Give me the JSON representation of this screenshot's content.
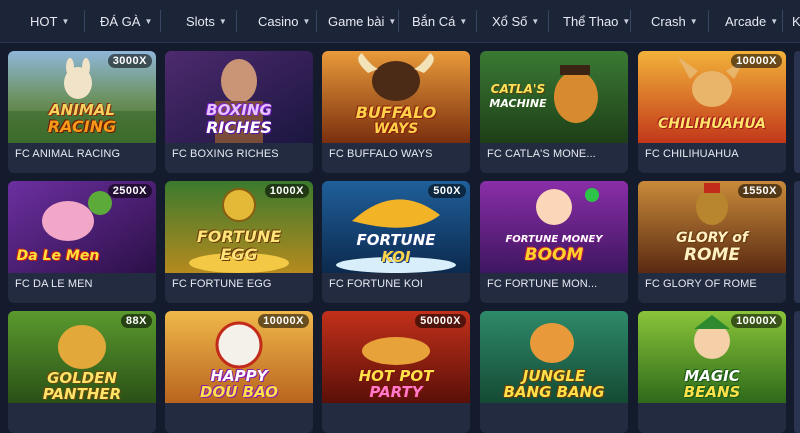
{
  "nav": {
    "items": [
      {
        "label": "HOT"
      },
      {
        "label": "ĐÁ GÀ"
      },
      {
        "label": "Slots"
      },
      {
        "label": "Casino"
      },
      {
        "label": "Game bài"
      },
      {
        "label": "Bắn Cá"
      },
      {
        "label": "Xổ Số"
      },
      {
        "label": "Thể Thao"
      },
      {
        "label": "Crash"
      },
      {
        "label": "Arcade"
      },
      {
        "label": "K"
      }
    ],
    "chevron_icon": "chevron-down-icon"
  },
  "games": [
    {
      "label": "FC ANIMAL RACING",
      "multiplier": "3000X",
      "logo_line1": "ANIMAL",
      "logo_line2": "RACING"
    },
    {
      "label": "FC BOXING RICHES",
      "multiplier": "",
      "logo_line1": "BOXING",
      "logo_line2": "RICHES"
    },
    {
      "label": "FC BUFFALO WAYS",
      "multiplier": "",
      "logo_line1": "BUFFALO",
      "logo_line2": "WAYS"
    },
    {
      "label": "FC CATLA'S MONE...",
      "multiplier": "",
      "logo_line1": "CATLA'S",
      "logo_line2": "MACHINE"
    },
    {
      "label": "FC CHILIHUAHUA",
      "multiplier": "10000X",
      "logo_line1": "",
      "logo_line2": "CHILIHUAHUA"
    },
    {
      "label": "FC DA LE MEN",
      "multiplier": "2500X",
      "logo_line1": "",
      "logo_line2": "Da Le Men"
    },
    {
      "label": "FC FORTUNE EGG",
      "multiplier": "1000X",
      "logo_line1": "FORTUNE",
      "logo_line2": "EGG"
    },
    {
      "label": "FC FORTUNE KOI",
      "multiplier": "500X",
      "logo_line1": "FORTUNE",
      "logo_line2": "KOI"
    },
    {
      "label": "FC FORTUNE MON...",
      "multiplier": "",
      "logo_line1": "FORTUNE MONEY",
      "logo_line2": "BOOM"
    },
    {
      "label": "FC GLORY OF ROME",
      "multiplier": "1550X",
      "logo_line1": "GLORY of",
      "logo_line2": "ROME"
    },
    {
      "label": "",
      "multiplier": "88X",
      "logo_line1": "GOLDEN",
      "logo_line2": "PANTHER"
    },
    {
      "label": "",
      "multiplier": "10000X",
      "logo_line1": "HAPPY",
      "logo_line2": "DOU BAO"
    },
    {
      "label": "",
      "multiplier": "50000X",
      "logo_line1": "HOT POT",
      "logo_line2": "PARTY"
    },
    {
      "label": "",
      "multiplier": "",
      "logo_line1": "JUNGLE",
      "logo_line2": "BANG BANG"
    },
    {
      "label": "",
      "multiplier": "10000X",
      "logo_line1": "MAGIC",
      "logo_line2": "BEANS"
    }
  ],
  "colors": {
    "page_bg": "#141b2d",
    "nav_bg": "#1c2437",
    "card_bg": "#222b40",
    "text": "#e7eaf2"
  }
}
